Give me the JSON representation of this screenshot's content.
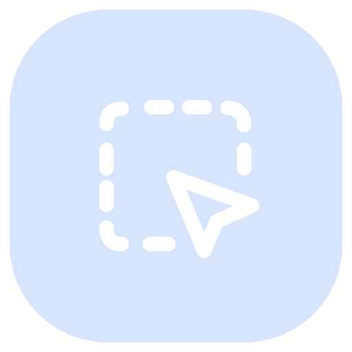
{
  "app_icon": {
    "icon": "select-area-cursor-icon",
    "tile_color": "#d6e4fc",
    "glyph_color": "#ffffff"
  }
}
